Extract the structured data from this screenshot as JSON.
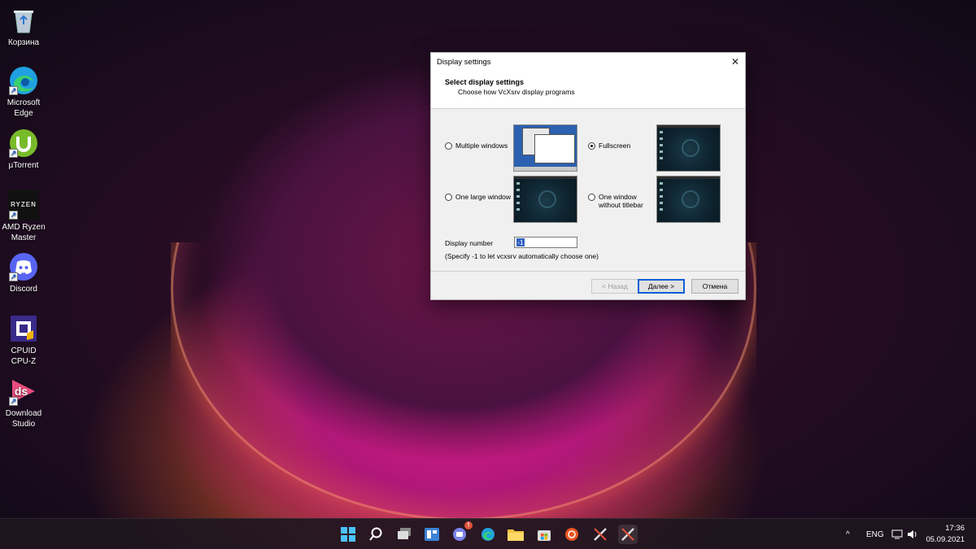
{
  "desktop": {
    "icons": [
      {
        "label": "Корзина"
      },
      {
        "label": "Microsoft Edge"
      },
      {
        "label": "µTorrent"
      },
      {
        "label": "AMD Ryzen Master"
      },
      {
        "label": "Discord"
      },
      {
        "label": "CPUID CPU-Z"
      },
      {
        "label": "Download Studio"
      }
    ],
    "icon_glyphs": {
      "ryzen": "RYZEN",
      "dlstudio": "ds"
    }
  },
  "dialog": {
    "title": "Display settings",
    "close_glyph": "✕",
    "heading": "Select display settings",
    "subheading": "Choose how VcXsrv display programs",
    "options": [
      {
        "label": "Multiple windows",
        "checked": false
      },
      {
        "label": "Fullscreen",
        "checked": true
      },
      {
        "label": "One large window",
        "checked": false
      },
      {
        "label": "One window without titlebar",
        "checked": false
      }
    ],
    "display_number_label": "Display number",
    "display_number_value": "-1",
    "display_number_hint": "(Specify -1 to let vcxsrv automatically choose one)",
    "buttons": {
      "back": "< Назад",
      "next": "Далее >",
      "cancel": "Отмена"
    }
  },
  "taskbar": {
    "notification_badge": "!",
    "tray": {
      "chevron": "^",
      "language": "ENG"
    },
    "time": "17:36",
    "date": "05.09.2021"
  },
  "colors": {
    "accent": "#0b5fd6",
    "edge": "#1fa0e0",
    "utorrent": "#78bb2a",
    "discord": "#5865f2",
    "dlstudio": "#e84c7d"
  }
}
